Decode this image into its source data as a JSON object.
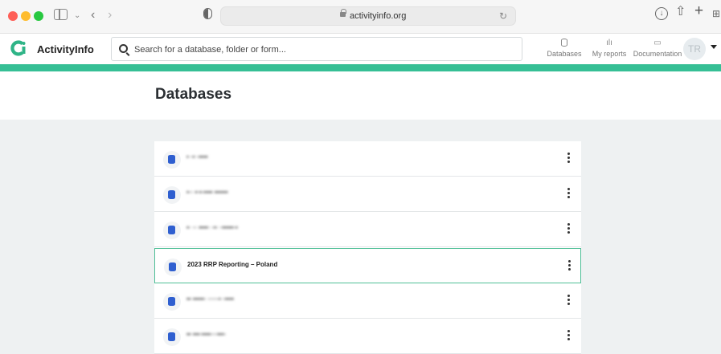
{
  "browser": {
    "url": "activityinfo.org",
    "icons": [
      "sidebar-icon",
      "chevron-down-icon",
      "back-icon",
      "forward-icon",
      "shield-icon",
      "lock-icon",
      "reload-icon",
      "download-icon",
      "share-icon",
      "plus-icon",
      "tabs-icon"
    ],
    "glyphs": {
      "back": "‹",
      "forward": "›",
      "chevron": "⌄",
      "reload": "↻",
      "download": "↓",
      "share": "⇧",
      "newtab": "+",
      "tabs": "⊞"
    }
  },
  "header": {
    "logo_text": "ActivityInfo",
    "search": {
      "placeholder": "Search for a database, folder or form..."
    },
    "nav": [
      {
        "label": "Databases",
        "icon": "database-icon"
      },
      {
        "label": "My reports",
        "icon": "bar-chart-icon"
      },
      {
        "label": "Documentation",
        "icon": "book-icon"
      }
    ],
    "avatar_initials": "TR",
    "report_glyph": "ılı",
    "doc_glyph": "▭"
  },
  "page": {
    "title": "Databases"
  },
  "databases": [
    {
      "name": "• ·• ·•••• ",
      "blurred": true
    },
    {
      "name": "•·· •·•·•••• ••••••",
      "blurred": true
    },
    {
      "name": "•· ·· ••••· ·•· ·•••••·•",
      "blurred": true
    },
    {
      "name": "2023 RRP Reporting – Poland",
      "blurred": false
    },
    {
      "name": "•• •••••· ·····• ·••••",
      "blurred": true
    },
    {
      "name": "•• •••·••••···•••·",
      "blurred": true
    }
  ],
  "colors": {
    "accent": "#36bf95",
    "db_icon": "#2f5fd0",
    "selected_border": "#4fbf97"
  }
}
